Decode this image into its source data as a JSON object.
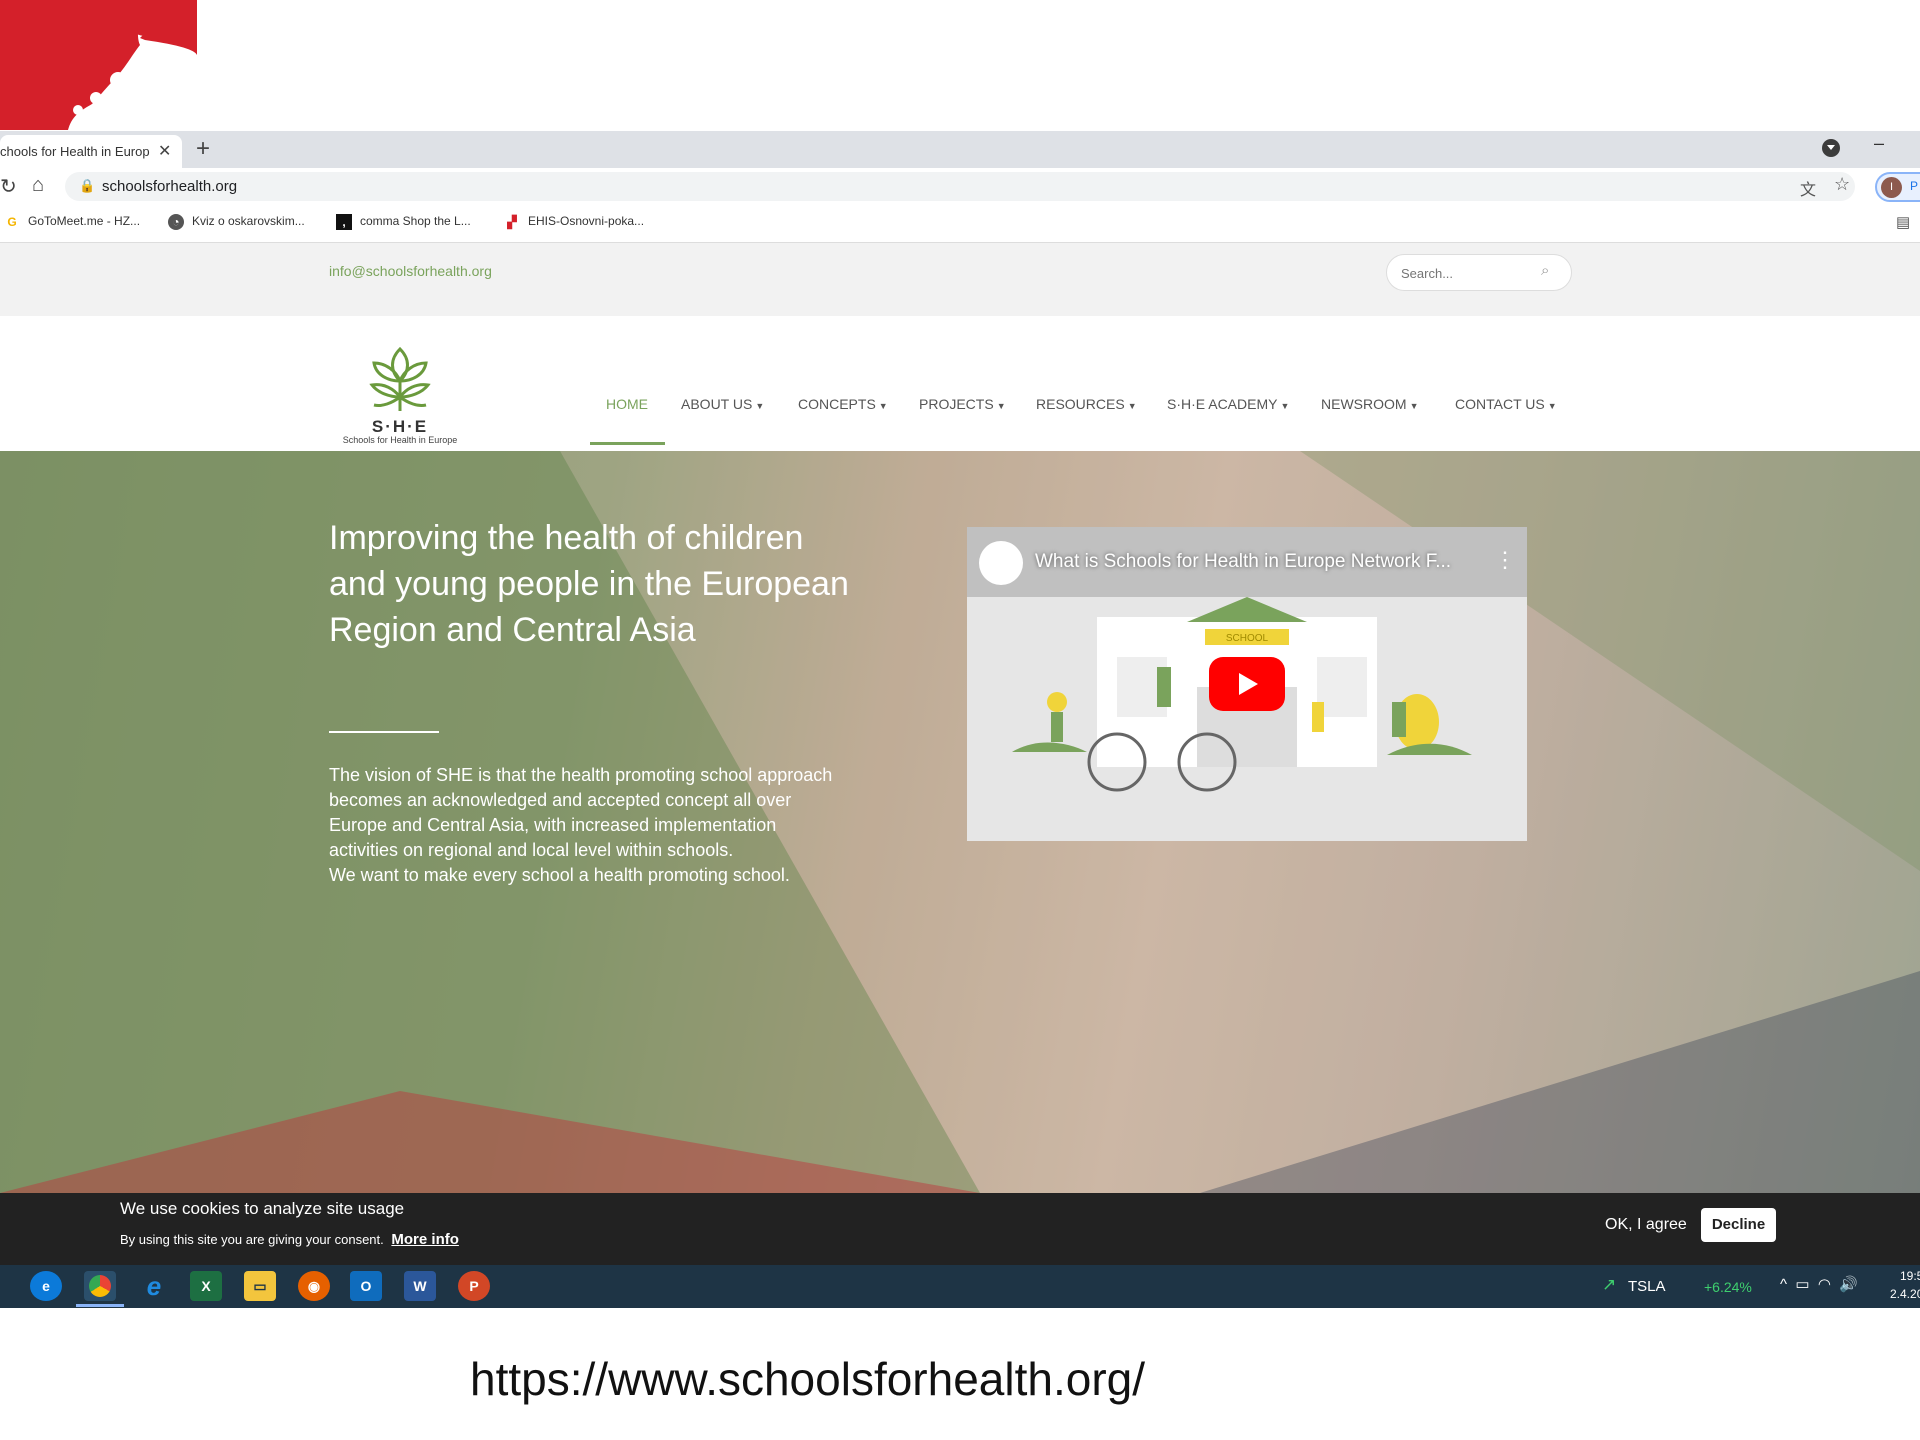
{
  "browser": {
    "tab_title": "chools for Health in Europ",
    "tab_close": "✕",
    "new_tab": "+",
    "url": "schoolsforhealth.org",
    "profile_initial": "I",
    "profile_label": "P",
    "bookmarks": [
      {
        "label": "GoToMeet.me - HZ...",
        "icon": "G"
      },
      {
        "label": "Kviz o oskarovskim...",
        "icon": "globe"
      },
      {
        "label": "comma Shop the L...",
        "icon": "comma"
      },
      {
        "label": "EHIS-Osnovni-poka...",
        "icon": "pdf"
      }
    ]
  },
  "site": {
    "email": "info@schoolsforhealth.org",
    "search_placeholder": "Search...",
    "logo_text": "S·H·E",
    "logo_subtext": "Schools for Health in Europe",
    "nav": [
      {
        "label": "HOME",
        "active": true
      },
      {
        "label": "ABOUT US",
        "dropdown": true
      },
      {
        "label": "CONCEPTS",
        "dropdown": true
      },
      {
        "label": "PROJECTS",
        "dropdown": true
      },
      {
        "label": "RESOURCES",
        "dropdown": true
      },
      {
        "label": "S·H·E ACADEMY",
        "dropdown": true
      },
      {
        "label": "NEWSROOM",
        "dropdown": true
      },
      {
        "label": "CONTACT US",
        "dropdown": true
      }
    ],
    "hero": {
      "title": "Improving the health of children and young people in the European Region and Central Asia",
      "paragraph1": "The vision of SHE is that the health promoting school approach becomes an acknowledged and accepted concept all over Europe and Central Asia, with increased implementation activities on regional and local level within schools.",
      "paragraph2": "We want to make every school a health promoting school."
    },
    "video": {
      "title": "What is Schools for Health in Europe Network F...",
      "school_sign": "SCHOOL"
    }
  },
  "cookie": {
    "heading": "We use cookies to analyze site usage",
    "body": "By using this site you are giving your consent.",
    "more_info": "More info",
    "agree": "OK, I agree",
    "decline": "Decline"
  },
  "taskbar": {
    "apps": [
      "edge-icon",
      "chrome-icon",
      "ie-icon",
      "excel-icon",
      "explorer-icon",
      "firefox-icon",
      "outlook-icon",
      "word-icon",
      "powerpoint-icon"
    ],
    "stock_ticker": "TSLA",
    "stock_change": "+6.24%",
    "clock_time": "19:5",
    "clock_date": "2.4.20"
  },
  "caption": "https://www.schoolsforhealth.org/",
  "colors": {
    "brand_green": "#7aa35c",
    "slide_red": "#d4202a",
    "cookie_bar": "#222222",
    "taskbar": "#1e3445"
  }
}
